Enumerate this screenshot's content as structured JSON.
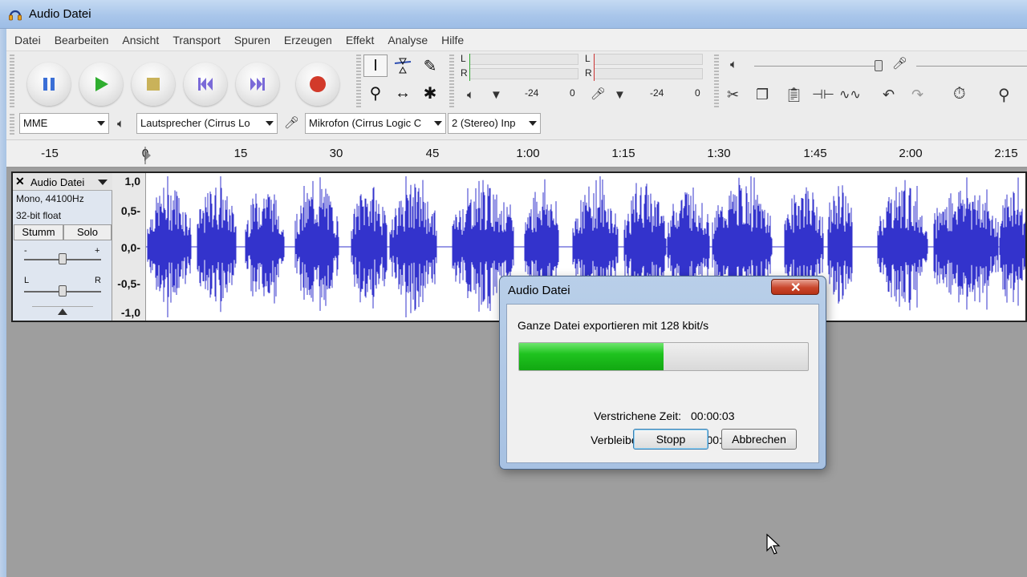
{
  "window": {
    "title": "Audio Datei"
  },
  "menu": [
    "Datei",
    "Bearbeiten",
    "Ansicht",
    "Transport",
    "Spuren",
    "Erzeugen",
    "Effekt",
    "Analyse",
    "Hilfe"
  ],
  "transport": [
    {
      "name": "pause-button",
      "icon": "pause-icon",
      "color": "#3b6fd6"
    },
    {
      "name": "play-button",
      "icon": "play-icon",
      "color": "#2fae2f"
    },
    {
      "name": "stop-button",
      "icon": "stop-icon",
      "color": "#c9b25a"
    },
    {
      "name": "skip-start-button",
      "icon": "skip-to-start-icon",
      "color": "#7a6ad8"
    },
    {
      "name": "skip-end-button",
      "icon": "skip-to-end-icon",
      "color": "#7a6ad8"
    },
    {
      "name": "record-button",
      "icon": "record-icon",
      "color": "#d23a2a"
    }
  ],
  "meters": {
    "left_label": "L",
    "right_label": "R",
    "play_min": "-24",
    "play_zero": "0",
    "rec_min": "-24",
    "rec_zero": "0"
  },
  "devices": {
    "host": "MME",
    "output": "Lautsprecher (Cirrus Lo",
    "input": "Mikrofon (Cirrus Logic C",
    "channels": "2 (Stereo) Inp"
  },
  "ruler": {
    "ticks": [
      "-15",
      "0",
      "15",
      "30",
      "45",
      "1:00",
      "1:15",
      "1:30",
      "1:45",
      "2:00",
      "2:15"
    ]
  },
  "track": {
    "name": "Audio Datei",
    "format": "Mono, 44100Hz",
    "bitdepth": "32-bit float",
    "mute_label": "Stumm",
    "solo_label": "Solo",
    "gain_minus": "-",
    "gain_plus": "+",
    "pan_left": "L",
    "pan_right": "R",
    "scale": [
      "1,0",
      "0,5-",
      "0,0-",
      "-0,5-",
      "-1,0"
    ],
    "wave_color": "#3333cc"
  },
  "dialog": {
    "title": "Audio Datei",
    "message": "Ganze Datei exportieren mit 128 kbit/s",
    "progress_fraction": 0.5,
    "elapsed_label": "Verstrichene Zeit:",
    "elapsed_value": "00:00:03",
    "remaining_label": "Verbleibende Zeit:",
    "remaining_value": "00:00:03",
    "stop_label": "Stopp",
    "cancel_label": "Abbrechen"
  }
}
